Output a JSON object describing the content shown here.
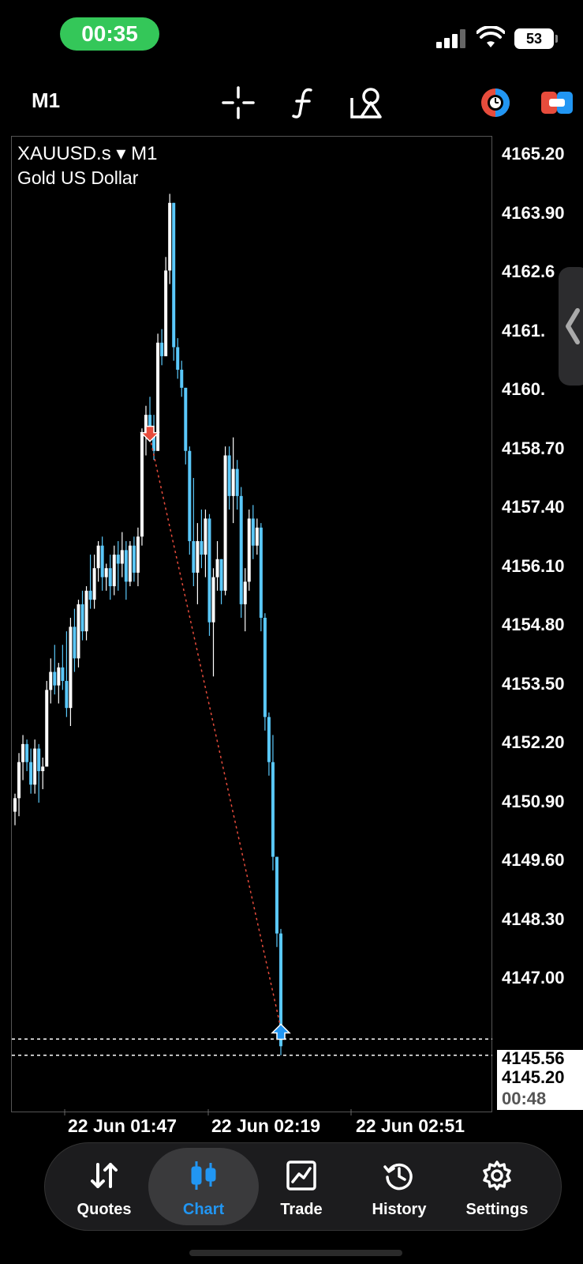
{
  "status_bar": {
    "time": "00:35",
    "battery": "53"
  },
  "toolbar": {
    "timeframe": "M1"
  },
  "chart_header": {
    "symbol": "XAUUSD.s ▾ M1",
    "description": "Gold US Dollar"
  },
  "price_axis": [
    "4165.20",
    "4163.90",
    "4162.6",
    "4161.",
    "4160.",
    "4158.70",
    "4157.40",
    "4156.10",
    "4154.80",
    "4153.50",
    "4152.20",
    "4150.90",
    "4149.60",
    "4148.30",
    "4147.00"
  ],
  "price_tags": {
    "bid": "4145.56",
    "ask": "4145.20",
    "countdown": "00:48"
  },
  "time_axis": [
    "22 Jun 01:47",
    "22 Jun 02:19",
    "22 Jun 02:51"
  ],
  "nav": [
    {
      "label": "Quotes",
      "icon": "quotes-icon"
    },
    {
      "label": "Chart",
      "icon": "chart-icon"
    },
    {
      "label": "Trade",
      "icon": "trade-icon"
    },
    {
      "label": "History",
      "icon": "history-icon"
    },
    {
      "label": "Settings",
      "icon": "settings-icon"
    }
  ],
  "colors": {
    "bull": "#ffffff",
    "bear": "#5ac8fa",
    "accent": "#2196f3",
    "sell_arrow": "#e74c3c",
    "buy_arrow": "#2196f3",
    "status_green": "#34c759"
  },
  "chart_data": {
    "type": "candlestick",
    "symbol": "XAUUSD.s",
    "timeframe": "M1",
    "ylim": [
      4144.6,
      4165.5
    ],
    "candles": [
      [
        4150.6,
        4151.0,
        4150.3,
        4150.9
      ],
      [
        4150.9,
        4151.9,
        4150.5,
        4151.7
      ],
      [
        4151.7,
        4152.3,
        4151.3,
        4152.1
      ],
      [
        4152.1,
        4152.2,
        4151.5,
        4151.7
      ],
      [
        4151.7,
        4152.0,
        4151.0,
        4151.2
      ],
      [
        4151.2,
        4152.2,
        4151.0,
        4152.0
      ],
      [
        4152.0,
        4152.1,
        4150.8,
        4151.5
      ],
      [
        4151.5,
        4151.8,
        4151.1,
        4151.6
      ],
      [
        4151.6,
        4153.5,
        4151.6,
        4153.3
      ],
      [
        4153.3,
        4154.0,
        4153.0,
        4153.7
      ],
      [
        4153.7,
        4154.3,
        4153.2,
        4153.4
      ],
      [
        4153.4,
        4153.9,
        4153.0,
        4153.8
      ],
      [
        4153.8,
        4154.3,
        4153.3,
        4153.5
      ],
      [
        4153.5,
        4154.6,
        4152.7,
        4152.9
      ],
      [
        4152.9,
        4154.9,
        4152.5,
        4154.7
      ],
      [
        4154.7,
        4155.1,
        4153.7,
        4154.0
      ],
      [
        4154.0,
        4155.3,
        4153.8,
        4155.2
      ],
      [
        4155.2,
        4155.5,
        4154.4,
        4154.6
      ],
      [
        4154.6,
        4155.6,
        4154.4,
        4155.5
      ],
      [
        4155.5,
        4156.3,
        4155.1,
        4155.3
      ],
      [
        4155.3,
        4156.3,
        4155.1,
        4156.0
      ],
      [
        4156.0,
        4156.6,
        4155.7,
        4156.5
      ],
      [
        4156.5,
        4156.7,
        4155.5,
        4155.8
      ],
      [
        4155.8,
        4156.1,
        4155.5,
        4156.0
      ],
      [
        4156.0,
        4156.3,
        4155.3,
        4155.6
      ],
      [
        4155.6,
        4156.5,
        4155.4,
        4156.3
      ],
      [
        4156.3,
        4156.6,
        4155.5,
        4156.1
      ],
      [
        4156.1,
        4156.8,
        4155.8,
        4156.4
      ],
      [
        4156.4,
        4156.6,
        4155.3,
        4155.7
      ],
      [
        4155.7,
        4156.6,
        4155.6,
        4156.5
      ],
      [
        4156.5,
        4156.7,
        4155.7,
        4155.9
      ],
      [
        4155.9,
        4156.9,
        4155.6,
        4156.7
      ],
      [
        4156.7,
        4159.1,
        4156.5,
        4159.0
      ],
      [
        4159.0,
        4159.6,
        4158.5,
        4159.4
      ],
      [
        4159.4,
        4159.8,
        4158.8,
        4159.0
      ],
      [
        4159.0,
        4159.4,
        4158.4,
        4158.6
      ],
      [
        4158.6,
        4161.2,
        4158.6,
        4161.0
      ],
      [
        4161.0,
        4161.3,
        4160.5,
        4160.7
      ],
      [
        4160.7,
        4162.9,
        4160.7,
        4162.6
      ],
      [
        4162.6,
        4164.3,
        4162.3,
        4164.1
      ],
      [
        4164.1,
        4164.1,
        4160.6,
        4160.9
      ],
      [
        4160.9,
        4161.1,
        4160.2,
        4160.4
      ],
      [
        4160.4,
        4160.6,
        4159.8,
        4160.0
      ],
      [
        4160.0,
        4160.0,
        4158.3,
        4158.6
      ],
      [
        4158.6,
        4158.7,
        4156.3,
        4156.6
      ],
      [
        4156.6,
        4158.0,
        4155.6,
        4155.9
      ],
      [
        4155.9,
        4157.0,
        4155.2,
        4156.6
      ],
      [
        4156.6,
        4157.3,
        4156.0,
        4156.3
      ],
      [
        4156.3,
        4157.3,
        4155.8,
        4157.1
      ],
      [
        4157.1,
        4157.2,
        4154.5,
        4154.8
      ],
      [
        4154.8,
        4156.0,
        4153.6,
        4155.8
      ],
      [
        4155.8,
        4156.6,
        4155.5,
        4156.2
      ],
      [
        4156.2,
        4156.2,
        4155.2,
        4155.5
      ],
      [
        4155.5,
        4158.7,
        4155.4,
        4158.5
      ],
      [
        4158.5,
        4158.7,
        4157.3,
        4157.6
      ],
      [
        4157.6,
        4158.9,
        4157.0,
        4158.2
      ],
      [
        4158.2,
        4158.4,
        4157.3,
        4157.6
      ],
      [
        4157.6,
        4157.8,
        4154.9,
        4155.2
      ],
      [
        4155.2,
        4156.0,
        4154.6,
        4155.7
      ],
      [
        4155.7,
        4157.3,
        4155.5,
        4157.1
      ],
      [
        4157.1,
        4157.4,
        4156.2,
        4156.5
      ],
      [
        4156.5,
        4157.1,
        4156.3,
        4156.9
      ],
      [
        4156.9,
        4157.0,
        4154.6,
        4154.9
      ],
      [
        4154.9,
        4155.0,
        4152.4,
        4152.7
      ],
      [
        4152.7,
        4152.8,
        4151.4,
        4151.7
      ],
      [
        4151.7,
        4152.3,
        4149.3,
        4149.6
      ],
      [
        4149.6,
        4149.6,
        4147.6,
        4147.9
      ],
      [
        4147.9,
        4148.0,
        4145.2,
        4145.4
      ]
    ],
    "sell_marker": {
      "index": 34,
      "price": 4158.9
    },
    "buy_marker": {
      "index": 67,
      "price": 4145.8
    },
    "h_lines": [
      4145.56,
      4145.2
    ]
  }
}
